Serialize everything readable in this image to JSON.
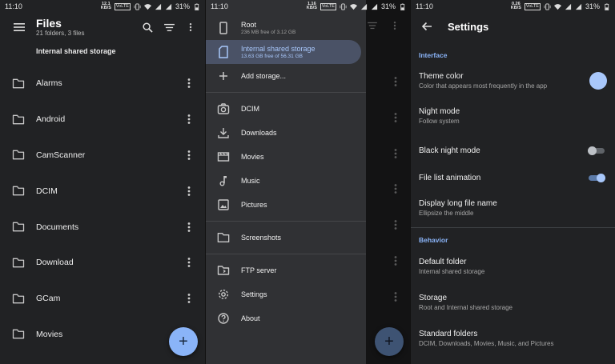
{
  "status": {
    "s1": {
      "time": "11:10",
      "speed_top": "12.1",
      "speed_bottom": "KB/S",
      "volte": "VoLTE",
      "battery": "31%"
    },
    "s2": {
      "time": "11:10",
      "speed_top": "1.16",
      "speed_bottom": "KB/S",
      "volte": "VoLTE",
      "battery": "31%"
    },
    "s3": {
      "time": "11:10",
      "speed_top": "0.26",
      "speed_bottom": "KB/S",
      "volte": "VoLTE",
      "battery": "31%"
    }
  },
  "files": {
    "title": "Files",
    "subtitle": "21 folders, 3 files",
    "breadcrumb": "Internal shared storage",
    "items": [
      "Alarms",
      "Android",
      "CamScanner",
      "DCIM",
      "Documents",
      "Download",
      "GCam",
      "Movies"
    ],
    "fab_label": "+"
  },
  "drawer": {
    "root": {
      "label": "Root",
      "sub": "236 MB free of 3.12 GB"
    },
    "internal": {
      "label": "Internal shared storage",
      "sub": "13.63 GB free of 56.31 GB"
    },
    "add_storage": "Add storage...",
    "dcim": "DCIM",
    "downloads": "Downloads",
    "movies": "Movies",
    "music": "Music",
    "pictures": "Pictures",
    "screenshots": "Screenshots",
    "ftp": "FTP server",
    "settings": "Settings",
    "about": "About",
    "fab_label": "+"
  },
  "settings": {
    "title": "Settings",
    "interface_header": "Interface",
    "theme_color": {
      "title": "Theme color",
      "summary": "Color that appears most frequently in the app"
    },
    "night_mode": {
      "title": "Night mode",
      "summary": "Follow system"
    },
    "black_night_mode": {
      "title": "Black night mode",
      "checked": false
    },
    "file_list_animation": {
      "title": "File list animation",
      "checked": true
    },
    "long_name": {
      "title": "Display long file name",
      "summary": "Ellipsize the middle"
    },
    "behavior_header": "Behavior",
    "default_folder": {
      "title": "Default folder",
      "summary": "Internal shared storage"
    },
    "storage": {
      "title": "Storage",
      "summary": "Root and Internal shared storage"
    },
    "standard_folders": {
      "title": "Standard folders",
      "summary": "DCIM, Downloads, Movies, Music, and Pictures"
    }
  },
  "colors": {
    "accent": "#8ab4f8",
    "background": "#212224",
    "drawer": "#303134",
    "active_item": "#4a5266"
  }
}
